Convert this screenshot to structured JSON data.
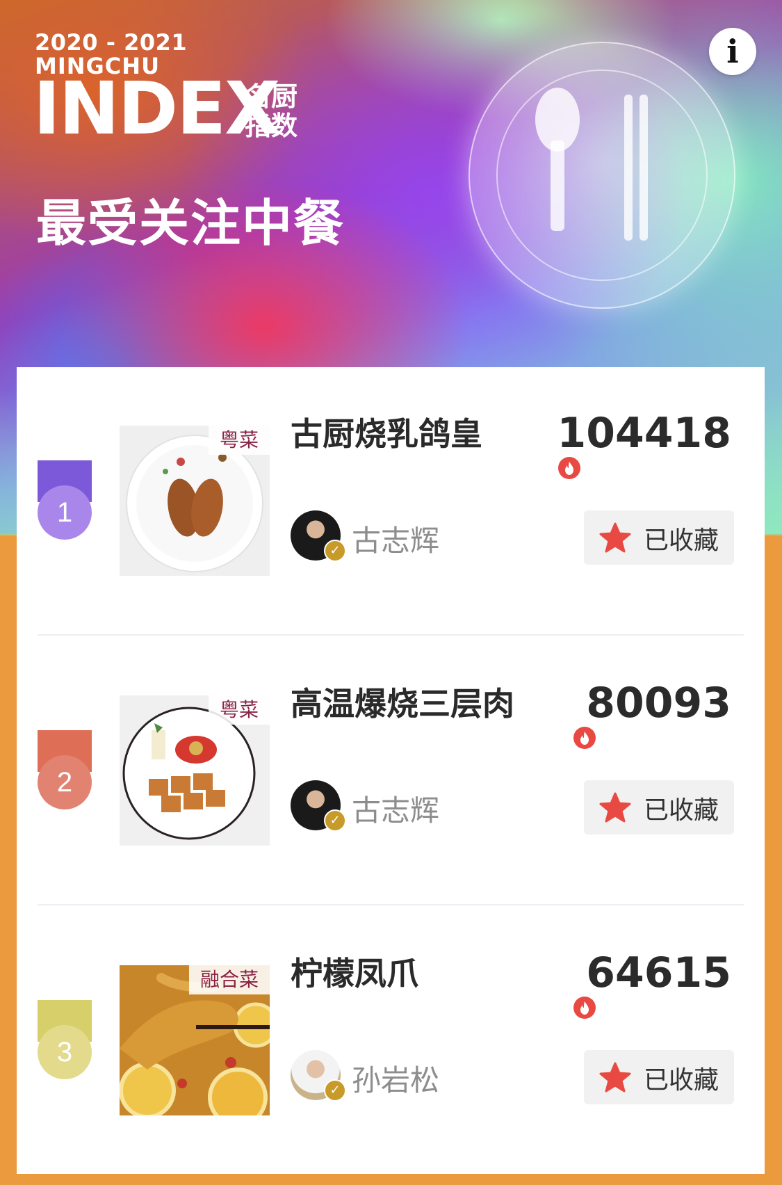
{
  "header": {
    "years": "2020 - 2021",
    "brand": "MINGCHU",
    "index_word": "INDEX",
    "index_cn": "名厨指数",
    "title": "最受关注中餐",
    "info_label": "i"
  },
  "colors": {
    "card_bg": "#ffffff",
    "page_bg": "#eb9a3e",
    "fire": "#e84a43",
    "star": "#e84a43",
    "tag_text": "#8a2244",
    "verified": "#c79a2a"
  },
  "list": [
    {
      "rank": "1",
      "medal_color": "#a987ea",
      "ribbon_color": "#7b59d8",
      "cuisine": "粤菜",
      "dish": "古厨烧乳鸽皇",
      "score": "104418",
      "chef": "古志辉",
      "fav_label": "已收藏",
      "image_icon": "roast-pigeon-plate"
    },
    {
      "rank": "2",
      "medal_color": "#e28372",
      "ribbon_color": "#df6e56",
      "cuisine": "粤菜",
      "dish": "高温爆烧三层肉",
      "score": "80093",
      "chef": "古志辉",
      "fav_label": "已收藏",
      "image_icon": "roast-pork-plate"
    },
    {
      "rank": "3",
      "medal_color": "#e3da8c",
      "ribbon_color": "#d6cf6a",
      "cuisine": "融合菜",
      "dish": "柠檬凤爪",
      "score": "64615",
      "chef": "孙岩松",
      "fav_label": "已收藏",
      "image_icon": "lemon-chicken-feet"
    }
  ]
}
